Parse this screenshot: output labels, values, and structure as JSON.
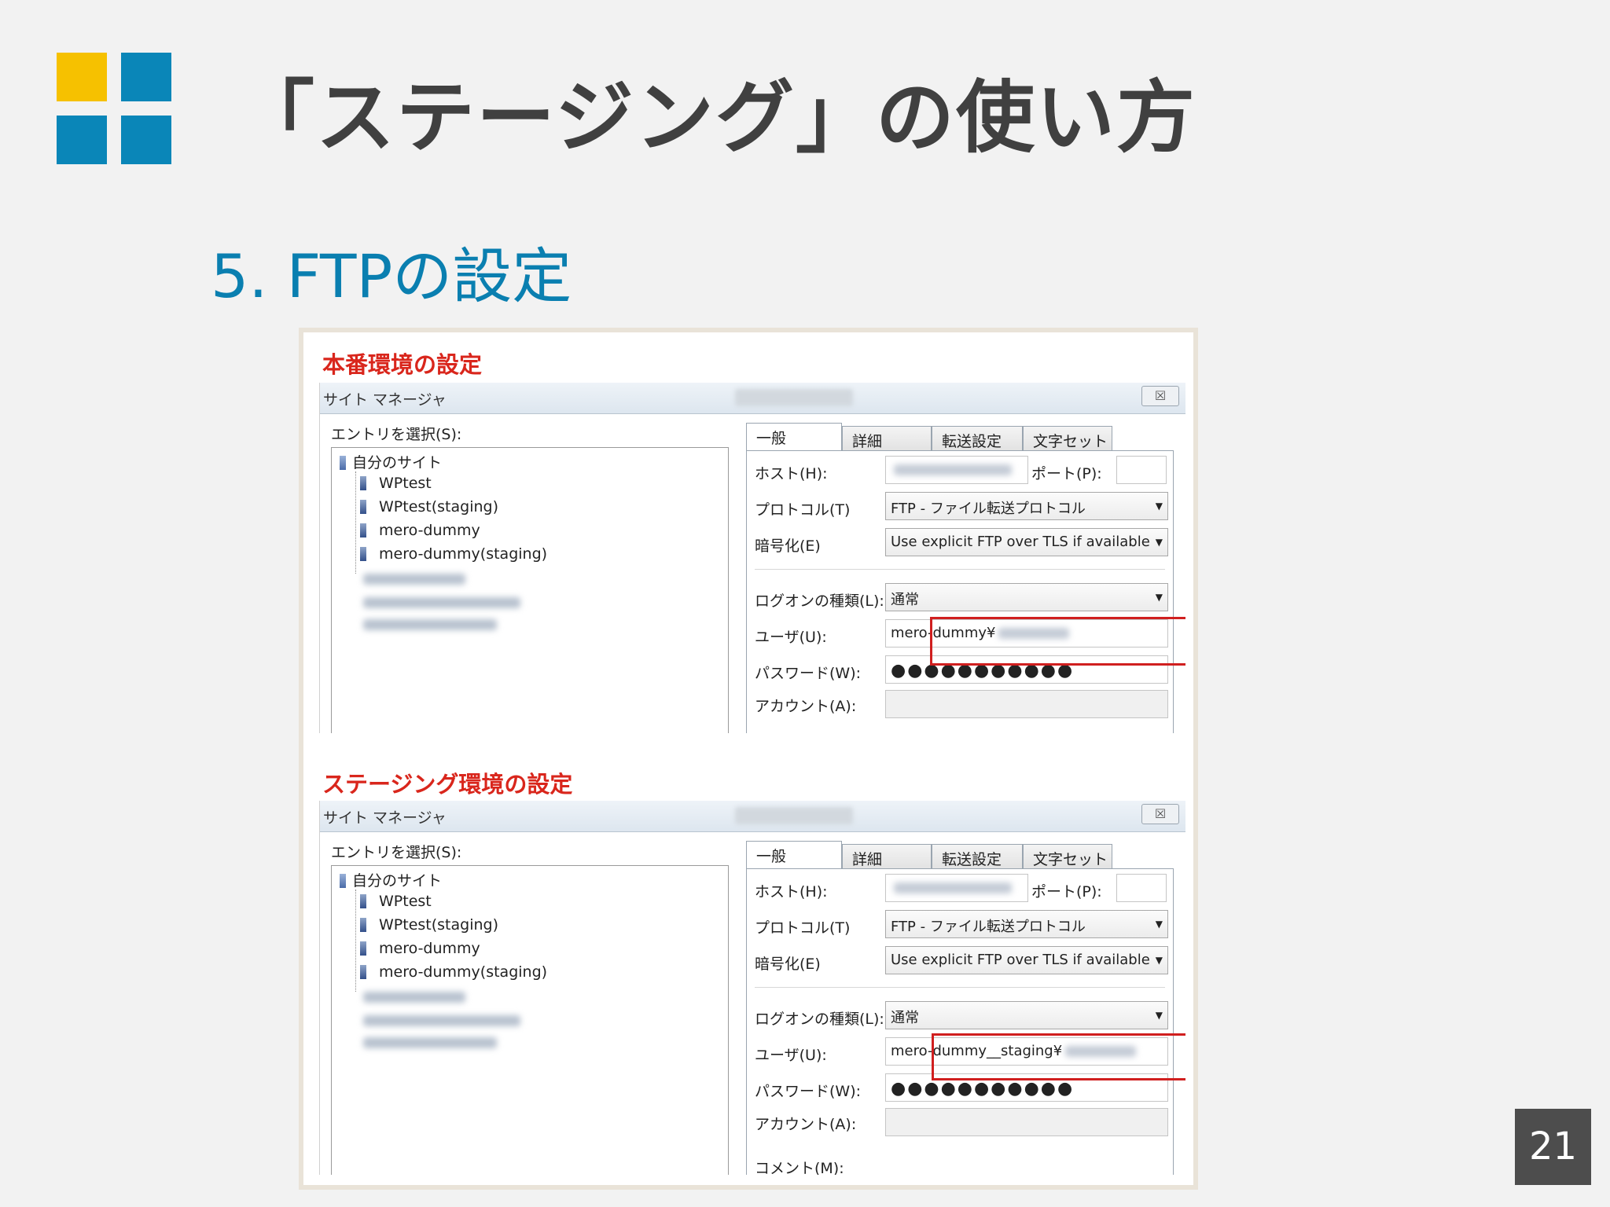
{
  "slide": {
    "title": "「ステージング」の使い方",
    "subtitle": "5.  FTPの設定",
    "page_number": "21"
  },
  "colors": {
    "accent_blue": "#0a86b8",
    "accent_yellow": "#f6c100",
    "highlight_red": "#d01f1f"
  },
  "production": {
    "heading": "本番環境の設定",
    "window_title": "サイト マネージャ",
    "close_glyph": "☒",
    "entry_label": "エントリを選択(S):",
    "tree_root": "自分のサイト",
    "tree_items": [
      "WPtest",
      "WPtest(staging)",
      "mero-dummy",
      "mero-dummy(staging)"
    ],
    "tabs": [
      "一般",
      "詳細",
      "転送設定",
      "文字セット"
    ],
    "host_label": "ホスト(H):",
    "port_label": "ポート(P):",
    "protocol_label": "プロトコル(T)",
    "protocol_value": "FTP - ファイル転送プロトコル",
    "encryption_label": "暗号化(E)",
    "encryption_value": "Use explicit FTP over TLS if available",
    "logon_label": "ログオンの種類(L):",
    "logon_value": "通常",
    "user_label": "ユーザ(U):",
    "user_value": "mero-dummy¥",
    "password_label": "パスワード(W):",
    "password_value": "●●●●●●●●●●●",
    "account_label": "アカウント(A):"
  },
  "staging": {
    "heading": "ステージング環境の設定",
    "window_title": "サイト マネージャ",
    "close_glyph": "☒",
    "entry_label": "エントリを選択(S):",
    "tree_root": "自分のサイト",
    "tree_items": [
      "WPtest",
      "WPtest(staging)",
      "mero-dummy",
      "mero-dummy(staging)"
    ],
    "tabs": [
      "一般",
      "詳細",
      "転送設定",
      "文字セット"
    ],
    "host_label": "ホスト(H):",
    "port_label": "ポート(P):",
    "protocol_label": "プロトコル(T)",
    "protocol_value": "FTP - ファイル転送プロトコル",
    "encryption_label": "暗号化(E)",
    "encryption_value": "Use explicit FTP over TLS if available",
    "logon_label": "ログオンの種類(L):",
    "logon_value": "通常",
    "user_label": "ユーザ(U):",
    "user_value": "mero-dummy__staging¥",
    "password_label": "パスワード(W):",
    "password_value": "●●●●●●●●●●●",
    "account_label": "アカウント(A):",
    "comment_label": "コメント(M):"
  }
}
